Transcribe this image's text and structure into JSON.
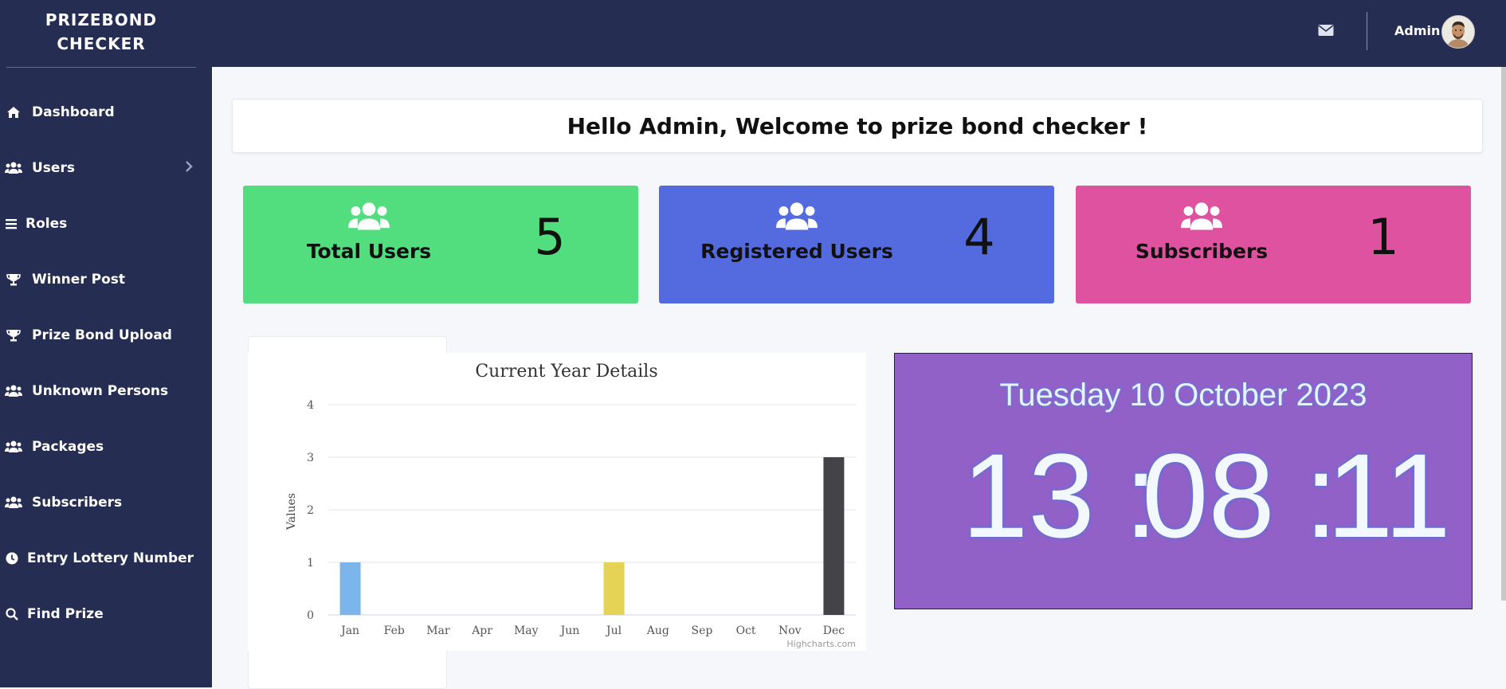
{
  "app": {
    "brand_line1": "PRIZEBOND",
    "brand_line2": "CHECKER"
  },
  "sidebar": {
    "items": [
      {
        "label": "Dashboard",
        "icon": "home-icon"
      },
      {
        "label": "Users",
        "icon": "users-icon",
        "has_submenu": true
      },
      {
        "label": "Roles",
        "icon": "list-icon"
      },
      {
        "label": "Winner Post",
        "icon": "trophy-icon"
      },
      {
        "label": "Prize Bond Upload",
        "icon": "trophy-icon"
      },
      {
        "label": "Unknown Persons",
        "icon": "users-icon"
      },
      {
        "label": "Packages",
        "icon": "users-icon"
      },
      {
        "label": "Subscribers",
        "icon": "users-icon"
      },
      {
        "label": "Entry Lottery Number",
        "icon": "clock-icon"
      },
      {
        "label": "Find Prize",
        "icon": "search-icon"
      }
    ]
  },
  "topbar": {
    "user_name": "Admin",
    "mail_icon": "envelope-icon"
  },
  "welcome": {
    "message": "Hello Admin, Welcome to prize bond checker !"
  },
  "stats": [
    {
      "label": "Total Users",
      "value": "5",
      "color": "#52de7f"
    },
    {
      "label": "Registered Users",
      "value": "4",
      "color": "#546be0"
    },
    {
      "label": "Subscribers",
      "value": "1",
      "color": "#df529f"
    }
  ],
  "chart_data": {
    "type": "bar",
    "title": "Current Year Details",
    "xlabel": "",
    "ylabel": "Values",
    "categories": [
      "Jan",
      "Feb",
      "Mar",
      "Apr",
      "May",
      "Jun",
      "Jul",
      "Aug",
      "Sep",
      "Oct",
      "Nov",
      "Dec"
    ],
    "values": [
      1,
      0,
      0,
      0,
      0,
      0,
      1,
      0,
      0,
      0,
      0,
      3
    ],
    "colors": [
      "#7cb5ec",
      "#434348",
      "#90ed7d",
      "#f7a35c",
      "#8085e9",
      "#f15c80",
      "#e4d354",
      "#2b908f",
      "#f45b5b",
      "#91e8e1",
      "#7cb5ec",
      "#434348"
    ],
    "ylim": [
      0,
      4
    ],
    "yticks": [
      0,
      1,
      2,
      3,
      4
    ],
    "grid": true,
    "credit": "Highcharts.com"
  },
  "clock": {
    "date": "Tuesday 10 October 2023",
    "hours": "13",
    "minutes": "08",
    "seconds": "11",
    "separator": ":"
  }
}
